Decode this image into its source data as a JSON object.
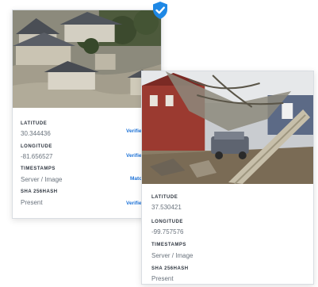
{
  "card1": {
    "fields": [
      {
        "label": "LATITUDE",
        "value": "30.344436",
        "status": "Verifie"
      },
      {
        "label": "LONGITUDE",
        "value": "-81.656527",
        "status": "Verifie"
      },
      {
        "label": "TIMESTAMPS",
        "value": "Server / Image",
        "status": "Match"
      },
      {
        "label": "SHA 256HASH",
        "value": "Present",
        "status": "Verifie"
      }
    ]
  },
  "card2": {
    "fields": [
      {
        "label": "LATITUDE",
        "value": "37.530421"
      },
      {
        "label": "LONGITUDE",
        "value": "-99.757576"
      },
      {
        "label": "TIMESTAMPS",
        "value": "Server / Image"
      },
      {
        "label": "SHA 256HASH",
        "value": "Present"
      }
    ]
  },
  "badge": {
    "icon": "verified-shield-check-icon",
    "color": "#1e88e5"
  },
  "colors": {
    "accent": "#1e73d8",
    "label": "#2f3640",
    "value": "#6a737d"
  }
}
